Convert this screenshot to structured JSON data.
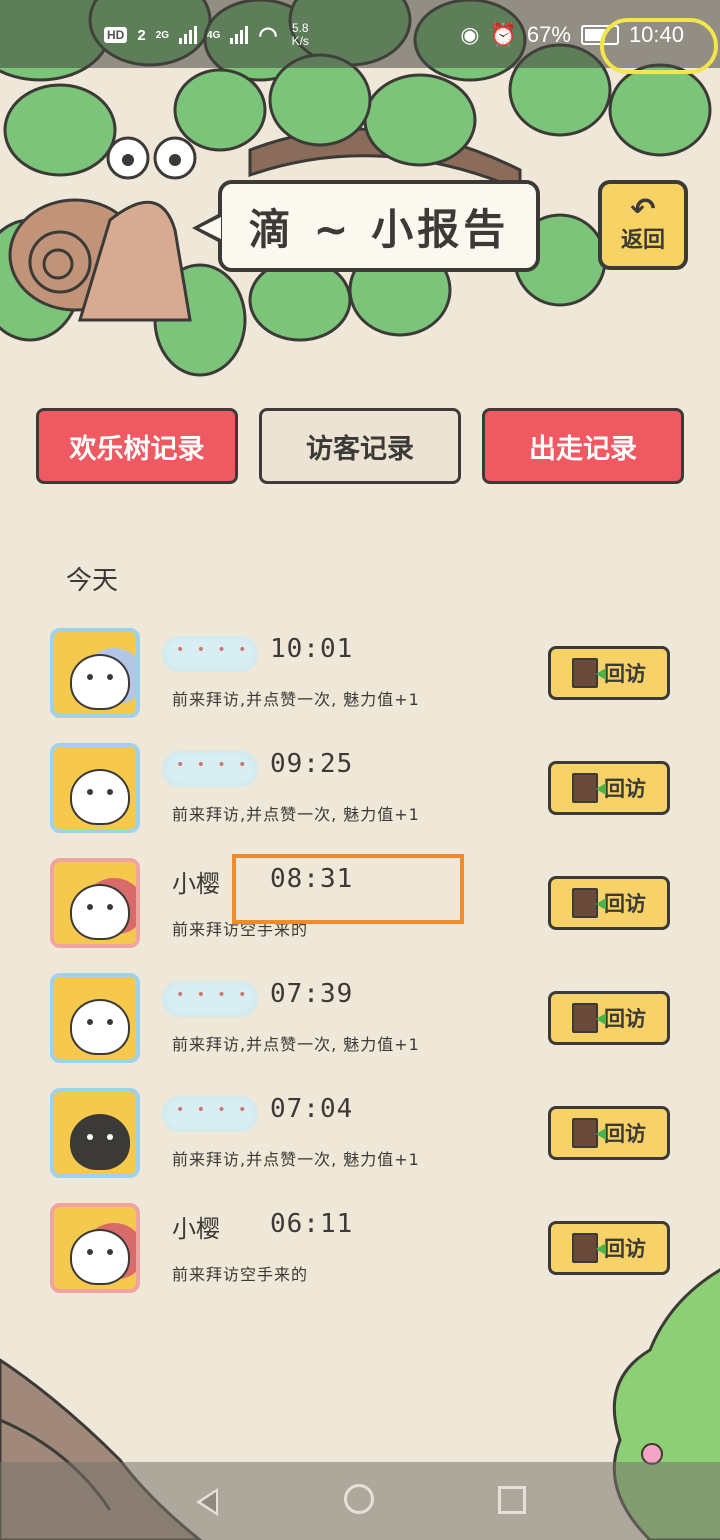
{
  "status_bar": {
    "hd": "HD",
    "sim_num": "2",
    "net1": "2G",
    "net2": "4G",
    "speed_value": "5.8",
    "speed_unit": "K/s",
    "battery": "67%",
    "time": "10:40"
  },
  "header": {
    "title": "滴 ~ 小报告",
    "back_arrow": "↶",
    "back_label": "返回"
  },
  "tabs": [
    {
      "label": "欢乐树记录"
    },
    {
      "label": "访客记录"
    },
    {
      "label": "出走记录"
    }
  ],
  "section_label": "今天",
  "visits": [
    {
      "name": "",
      "time": "10:01",
      "desc": "前来拜访,并点赞一次, 魅力值+1",
      "action": "回访",
      "avatar": "hedgehog"
    },
    {
      "name": "",
      "time": "09:25",
      "desc": "前来拜访,并点赞一次, 魅力值+1",
      "action": "回访",
      "avatar": "panda"
    },
    {
      "name": "小樱",
      "time": "08:31",
      "desc": "前来拜访空手来的",
      "action": "回访",
      "avatar": "pink-hedgehog"
    },
    {
      "name": "",
      "time": "07:39",
      "desc": "前来拜访,并点赞一次, 魅力值+1",
      "action": "回访",
      "avatar": "panda"
    },
    {
      "name": "",
      "time": "07:04",
      "desc": "前来拜访,并点赞一次, 魅力值+1",
      "action": "回访",
      "avatar": "penguin"
    },
    {
      "name": "小樱",
      "time": "06:11",
      "desc": "前来拜访空手来的",
      "action": "回访",
      "avatar": "pink-hedgehog"
    }
  ],
  "colors": {
    "background": "#efe7d8",
    "tab_active": "#ef5a62",
    "button_yellow": "#f6d268",
    "leaf_green": "#7cc47a",
    "annotation_orange": "#f08a2e",
    "annotation_yellow": "#f2e64a"
  }
}
